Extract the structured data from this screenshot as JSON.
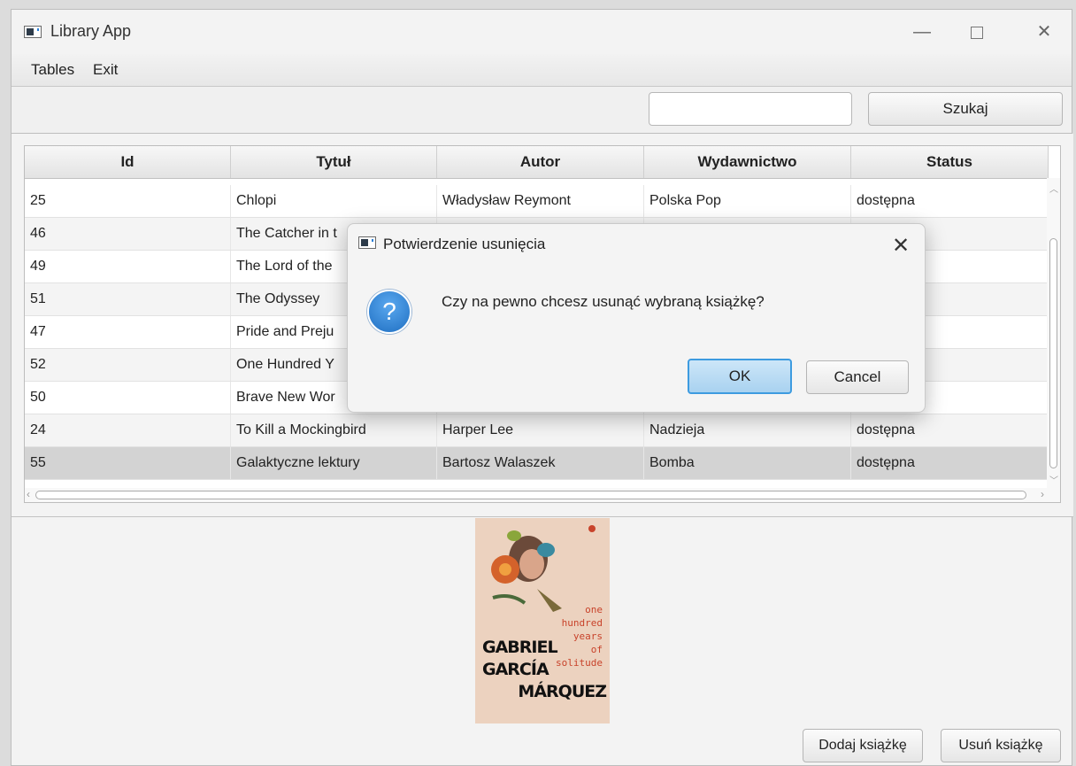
{
  "window": {
    "title": "Library App",
    "controls": {
      "minimize": "—",
      "close": "✕"
    }
  },
  "menu": [
    "Tables",
    "Exit"
  ],
  "toolbar": {
    "search_value": "",
    "search_placeholder": "",
    "search_button": "Szukaj"
  },
  "table": {
    "columns": [
      "Id",
      "Tytuł",
      "Autor",
      "Wydawnictwo",
      "Status"
    ],
    "rows": [
      [
        "25",
        "Chlopi",
        "Władysław Reymont",
        "Polska Pop",
        "dostępna"
      ],
      [
        "46",
        "The Catcher in t",
        "",
        "",
        ""
      ],
      [
        "49",
        "The Lord of the",
        "",
        "",
        ""
      ],
      [
        "51",
        "The Odyssey",
        "",
        "",
        "zona"
      ],
      [
        "47",
        "Pride and Preju",
        "",
        "",
        "zona"
      ],
      [
        "52",
        "One Hundred Y",
        "",
        "",
        "zona"
      ],
      [
        "50",
        "Brave New Wor",
        "",
        "",
        ""
      ],
      [
        "24",
        "To Kill a Mockingbird",
        "Harper Lee",
        "Nadzieja",
        "dostępna"
      ],
      [
        "55",
        "Galaktyczne lektury",
        "Bartosz Walaszek",
        "Bomba",
        "dostępna"
      ]
    ],
    "selected_row": 8
  },
  "cover": {
    "lines": [
      "one",
      "hundred",
      "years",
      "of",
      "solitude"
    ],
    "author": [
      "GABRIEL",
      "GARCÍA",
      "MÁRQUEZ"
    ]
  },
  "buttons": {
    "add": "Dodaj książkę",
    "remove": "Usuń książkę"
  },
  "dialog": {
    "title": "Potwierdzenie usunięcia",
    "message": "Czy na pewno chcesz usunąć wybraną książkę?",
    "ok": "OK",
    "cancel": "Cancel",
    "close": "✕",
    "icon": "?"
  },
  "colors": {
    "accent": "#3d9be0",
    "question_icon": "#2a7fd6",
    "cover_bg": "#ecd2bf",
    "cover_text": "#c8432b"
  }
}
